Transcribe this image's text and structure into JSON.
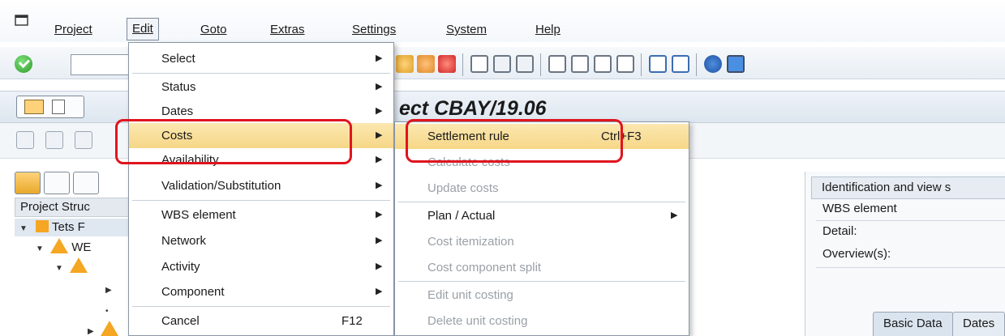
{
  "menubar": {
    "items": [
      {
        "label": "Project"
      },
      {
        "label": "Edit"
      },
      {
        "label": "Goto"
      },
      {
        "label": "Extras"
      },
      {
        "label": "Settings"
      },
      {
        "label": "System"
      },
      {
        "label": "Help"
      }
    ]
  },
  "title": {
    "prefix_letter": "",
    "text": "ect CBAY/19.06"
  },
  "tree": {
    "header": "Project Struc",
    "rows": [
      {
        "label": "Tets F"
      },
      {
        "label": "WE"
      }
    ]
  },
  "right_panel": {
    "header": "Identification and view s",
    "labels": [
      "WBS element",
      "Detail:",
      "Overview(s):"
    ],
    "tabs": [
      "Basic Data",
      "Dates"
    ]
  },
  "edit_menu": {
    "items": [
      {
        "label": "Select",
        "has_submenu": true
      },
      {
        "label": "Status",
        "has_submenu": true
      },
      {
        "label": "Dates",
        "has_submenu": true
      },
      {
        "label": "Costs",
        "has_submenu": true,
        "highlighted": true
      },
      {
        "label": "Availability",
        "has_submenu": true
      },
      {
        "label": "Validation/Substitution",
        "has_submenu": true
      },
      {
        "label": "WBS element",
        "has_submenu": true
      },
      {
        "label": "Network",
        "has_submenu": true
      },
      {
        "label": "Activity",
        "has_submenu": true
      },
      {
        "label": "Component",
        "has_submenu": true
      },
      {
        "label": "Cancel",
        "shortcut": "F12"
      }
    ]
  },
  "costs_submenu": {
    "items": [
      {
        "label": "Settlement rule",
        "shortcut": "Ctrl+F3",
        "highlighted": true
      },
      {
        "label": "Calculate costs",
        "disabled": true
      },
      {
        "label": "Update costs",
        "disabled": true
      },
      {
        "label": "Plan / Actual",
        "has_submenu": true
      },
      {
        "label": "Cost itemization",
        "disabled": true
      },
      {
        "label": "Cost component split",
        "disabled": true
      },
      {
        "label": "Edit unit costing",
        "disabled": true
      },
      {
        "label": "Delete unit costing",
        "disabled": true
      }
    ]
  },
  "colors": {
    "highlight": "#f6d787",
    "callout": "#e0141e",
    "warning": "#f5a623"
  }
}
